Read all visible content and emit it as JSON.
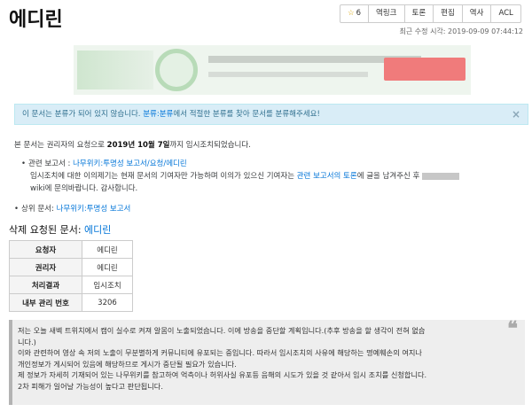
{
  "title": "에디린",
  "toolbar": {
    "star_count": "6",
    "backlinks": "역링크",
    "discuss": "토론",
    "edit": "편집",
    "history": "역사",
    "acl": "ACL"
  },
  "meta": {
    "last_modified": "최근 수정 시각: 2019-09-09 07:44:12"
  },
  "alert": {
    "text_before": "이 문서는 분류가 되어 있지 않습니다. ",
    "link": "분류:분류",
    "text_after": "에서 적절한 분류를 찾아 문서를 분류해주세요!",
    "close": "×"
  },
  "notice": {
    "prefix": "본 문서는 권리자의 요청으로 ",
    "date": "2019년 10월 7일",
    "suffix": "까지 임시조치되었습니다."
  },
  "report": {
    "label": "관련 보고서 : ",
    "link": "나무위키:투명성 보고서/요청/에디린",
    "line2a": "임시조치에 대한 이의제기는 현재 문서의 기여자만 가능하며 이의가 있으신 기여자는 ",
    "line2link": "관련 보고서의 토론",
    "line2b": "에 글을 남겨주신 후",
    "line3": "wiki에 문의바랍니다. 감사합니다."
  },
  "parent": {
    "label": "상위 문서: ",
    "link": "나무위키:투명성 보고서"
  },
  "delete_table": {
    "caption_prefix": "삭제 요청된 문서: ",
    "caption_link": "에디린",
    "rows": [
      {
        "key": "요청자",
        "value": "에디린"
      },
      {
        "key": "권리자",
        "value": "에디린"
      },
      {
        "key": "처리결과",
        "value": "임시조치"
      },
      {
        "key": "내부 관리 번호",
        "value": "3206"
      }
    ]
  },
  "quote": {
    "lines": [
      "저는 오늘 새벽 트위치에서 캠이 실수로 켜져 알몸이 노출되었습니다. 이에 방송을 중단할 계획입니다.(추후 방송을 할 생각이 전혀 없습",
      "니다.)",
      "이와 관련하여 영상 속 저의 노출이 무분별하게 커뮤니티에 유포되는 중입니다. 따라서 임시조치의 사유에 해당하는 명예훼손의 여지나",
      "개인정보가 게시되어 있음에 해당하므로 게시가 중단될 필요가 있습니다.",
      "제 정보가 자세히 기재되어 있는 나무위키를 참고하여 억측이나 허위사실 유포등 음해의 시도가 있을 것 같아서 임시 조치를 신청합니다.",
      "2차 피해가 일어날 가능성이 높다고 판단됩니다."
    ],
    "mark": "❝"
  }
}
